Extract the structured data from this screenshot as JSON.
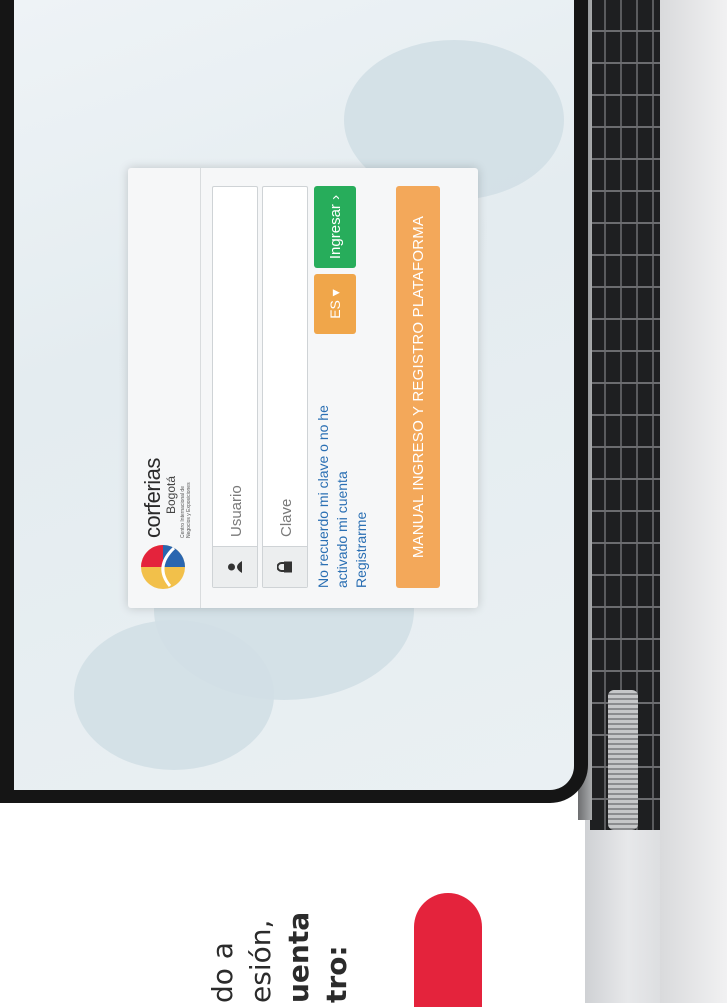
{
  "caption": {
    "lines": [
      "do a",
      "esión,",
      "uenta",
      "tro:"
    ]
  },
  "login": {
    "brand_name": "corferias",
    "brand_city": "Bogotá",
    "brand_tag": "Centro Internacional de Negocios y Exposiciones",
    "username_placeholder": "Usuario",
    "password_placeholder": "Clave",
    "forgot_link": "No recuerdo mi clave o no he activado mi cuenta",
    "register_link": "Registrarme",
    "language_button": "ES ▾",
    "login_button": "Ingresar ›",
    "manual_button": "MANUAL INGRESO Y REGISTRO PLATAFORMA"
  },
  "colors": {
    "accent_red": "#e4233c",
    "login_green": "#27ad5b",
    "orange": "#f3a85a",
    "link_blue": "#2a6fb3"
  },
  "icons": [
    "user-icon",
    "lock-icon",
    "corferias-logo"
  ]
}
